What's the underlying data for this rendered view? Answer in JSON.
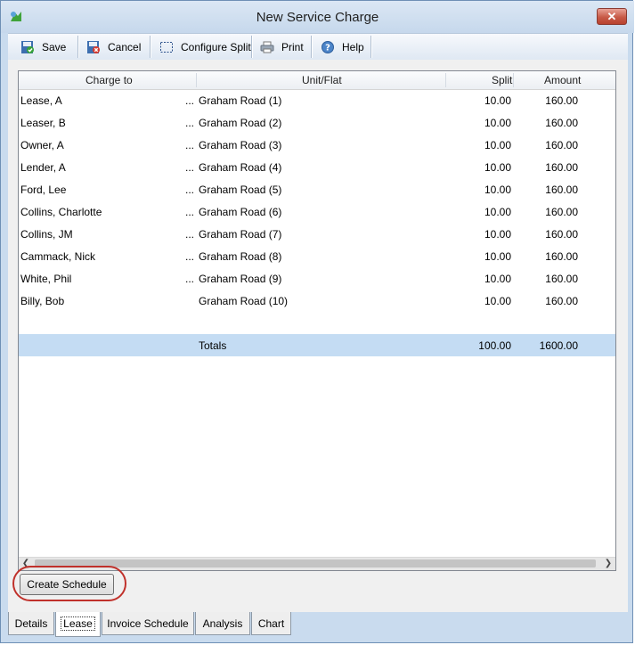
{
  "window": {
    "title": "New Service Charge"
  },
  "toolbar": {
    "save_label": "Save",
    "cancel_label": "Cancel",
    "configure_split_label": "Configure Split",
    "print_label": "Print",
    "help_label": "Help"
  },
  "grid": {
    "columns": [
      "Charge to",
      "Unit/Flat",
      "Split",
      "Amount"
    ],
    "rows": [
      {
        "charge_to": "Lease, A",
        "ellipsis": "...",
        "unit": "Graham Road (1)",
        "split": "10.00",
        "amount": "160.00"
      },
      {
        "charge_to": "Leaser, B",
        "ellipsis": "...",
        "unit": "Graham Road (2)",
        "split": "10.00",
        "amount": "160.00"
      },
      {
        "charge_to": "Owner, A",
        "ellipsis": "...",
        "unit": "Graham Road (3)",
        "split": "10.00",
        "amount": "160.00"
      },
      {
        "charge_to": "Lender, A",
        "ellipsis": "...",
        "unit": "Graham Road (4)",
        "split": "10.00",
        "amount": "160.00"
      },
      {
        "charge_to": "Ford, Lee",
        "ellipsis": "...",
        "unit": "Graham Road (5)",
        "split": "10.00",
        "amount": "160.00"
      },
      {
        "charge_to": "Collins, Charlotte",
        "ellipsis": "...",
        "unit": "Graham Road (6)",
        "split": "10.00",
        "amount": "160.00"
      },
      {
        "charge_to": "Collins, JM",
        "ellipsis": "...",
        "unit": "Graham Road (7)",
        "split": "10.00",
        "amount": "160.00"
      },
      {
        "charge_to": "Cammack, Nick",
        "ellipsis": "...",
        "unit": "Graham Road (8)",
        "split": "10.00",
        "amount": "160.00"
      },
      {
        "charge_to": "White, Phil",
        "ellipsis": "...",
        "unit": "Graham Road (9)",
        "split": "10.00",
        "amount": "160.00"
      },
      {
        "charge_to": "Billy, Bob",
        "ellipsis": "",
        "unit": "Graham Road (10)",
        "split": "10.00",
        "amount": "160.00"
      }
    ],
    "totals": {
      "label": "Totals",
      "split": "100.00",
      "amount": "1600.00"
    }
  },
  "create_schedule_label": "Create Schedule",
  "tabs": [
    {
      "label": "Details",
      "active": false
    },
    {
      "label": "Lease",
      "active": true
    },
    {
      "label": "Invoice Schedule",
      "active": false
    },
    {
      "label": "Analysis",
      "active": false
    },
    {
      "label": "Chart",
      "active": false
    }
  ],
  "colors": {
    "totals_row": "#c4dcf3",
    "highlight_ring": "#c0312b",
    "close_button": "#c75a47"
  }
}
